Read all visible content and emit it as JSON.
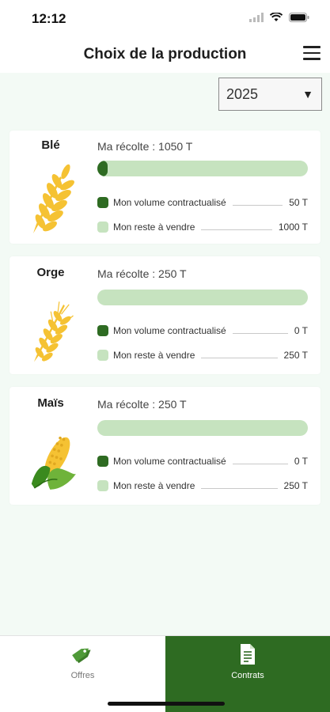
{
  "status_bar": {
    "time": "12:12"
  },
  "header": {
    "title": "Choix de la production",
    "menu_icon": "hamburger-menu-icon"
  },
  "year_selector": {
    "selected": "2025",
    "caret": "▼"
  },
  "colors": {
    "accent_dark": "#2e6b22",
    "accent_light": "#c6e3bf",
    "grain": "#f5c233"
  },
  "crops": [
    {
      "name": "Blé",
      "icon": "wheat-icon",
      "harvest_label": "Ma récolte : 1050 T",
      "contracted_fraction": 0.048,
      "contracted_label": "Mon volume contractualisé",
      "contracted_value": "50 T",
      "remaining_label": "Mon reste à vendre",
      "remaining_value": "1000 T"
    },
    {
      "name": "Orge",
      "icon": "barley-icon",
      "harvest_label": "Ma récolte : 250 T",
      "contracted_fraction": 0,
      "contracted_label": "Mon volume contractualisé",
      "contracted_value": "0 T",
      "remaining_label": "Mon reste à vendre",
      "remaining_value": "250 T"
    },
    {
      "name": "Maïs",
      "icon": "corn-icon",
      "harvest_label": "Ma récolte : 250 T",
      "contracted_fraction": 0,
      "contracted_label": "Mon volume contractualisé",
      "contracted_value": "0 T",
      "remaining_label": "Mon reste à vendre",
      "remaining_value": "250 T"
    }
  ],
  "tabs": [
    {
      "label": "Offres",
      "icon": "price-tags-icon",
      "active": false
    },
    {
      "label": "Contrats",
      "icon": "document-icon",
      "active": true
    }
  ]
}
